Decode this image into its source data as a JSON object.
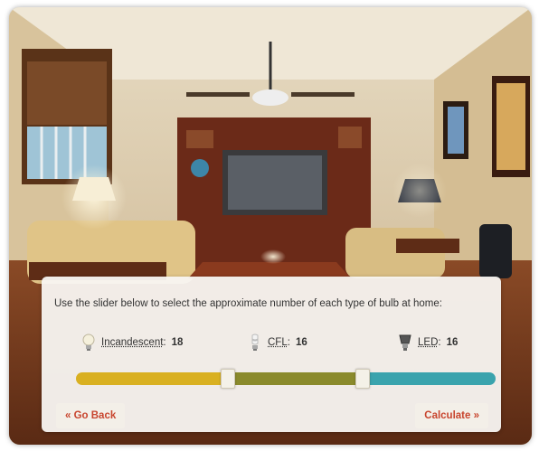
{
  "panel": {
    "instruction": "Use the slider below to select the approximate number of each type of bulb at home:"
  },
  "bulbs": [
    {
      "name": "Incandescent",
      "colon": ":",
      "value": "18",
      "icon": "incandescent-bulb-icon"
    },
    {
      "name": "CFL",
      "colon": ":",
      "value": "16",
      "icon": "cfl-bulb-icon"
    },
    {
      "name": "LED",
      "colon": ":",
      "value": "16",
      "icon": "led-bulb-icon"
    }
  ],
  "slider": {
    "colors": {
      "incandescent": "#d9b021",
      "cfl": "#8a8a2c",
      "led": "#3aa3ad"
    },
    "split_fractions": [
      0.36,
      0.68
    ]
  },
  "buttons": {
    "back": "« Go Back",
    "calculate": "Calculate »"
  },
  "colors": {
    "accent": "#c8452e"
  }
}
